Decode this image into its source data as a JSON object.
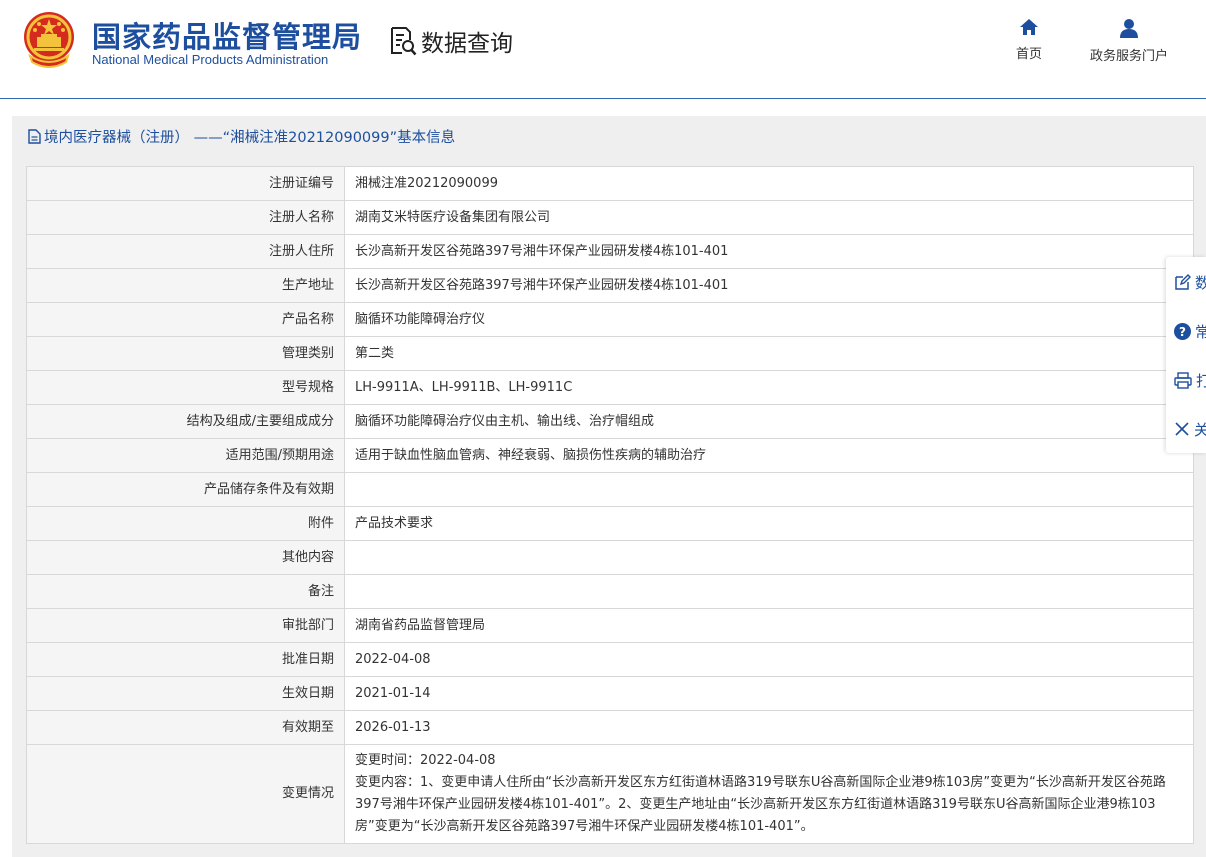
{
  "header": {
    "title_cn": "国家药品监督管理局",
    "title_en": "National Medical Products Administration",
    "query_label": "数据查询",
    "nav": {
      "home_label": "首页",
      "portal_label": "政务服务门户"
    }
  },
  "page": {
    "title": "境内医疗器械（注册） ——“湘械注准20212090099”基本信息"
  },
  "side_panel": {
    "items": [
      {
        "label": "数",
        "icon": "edit-icon"
      },
      {
        "label": "常",
        "icon": "help-icon"
      },
      {
        "label": "打",
        "icon": "print-icon"
      },
      {
        "label": "关",
        "icon": "close-icon"
      }
    ]
  },
  "details": {
    "rows": [
      {
        "label": "注册证编号",
        "value": "湘械注准20212090099"
      },
      {
        "label": "注册人名称",
        "value": "湖南艾米特医疗设备集团有限公司"
      },
      {
        "label": "注册人住所",
        "value": "长沙高新开发区谷苑路397号湘牛环保产业园研发楼4栋101-401"
      },
      {
        "label": "生产地址",
        "value": "长沙高新开发区谷苑路397号湘牛环保产业园研发楼4栋101-401"
      },
      {
        "label": "产品名称",
        "value": "脑循环功能障碍治疗仪"
      },
      {
        "label": "管理类别",
        "value": "第二类"
      },
      {
        "label": "型号规格",
        "value": "LH-9911A、LH-9911B、LH-9911C"
      },
      {
        "label": "结构及组成/主要组成成分",
        "value": "脑循环功能障碍治疗仪由主机、输出线、治疗帽组成"
      },
      {
        "label": "适用范围/预期用途",
        "value": "适用于缺血性脑血管病、神经衰弱、脑损伤性疾病的辅助治疗"
      },
      {
        "label": "产品储存条件及有效期",
        "value": ""
      },
      {
        "label": "附件",
        "value": "产品技术要求"
      },
      {
        "label": "其他内容",
        "value": ""
      },
      {
        "label": "备注",
        "value": ""
      },
      {
        "label": "审批部门",
        "value": "湖南省药品监督管理局"
      },
      {
        "label": "批准日期",
        "value": "2022-04-08"
      },
      {
        "label": "生效日期",
        "value": "2021-01-14"
      },
      {
        "label": "有效期至",
        "value": "2026-01-13"
      }
    ],
    "change": {
      "label": "变更情况",
      "time": "变更时间：2022-04-08",
      "content": "变更内容：1、变更申请人住所由“长沙高新开发区东方红街道林语路319号联东U谷高新国际企业港9栋103房”变更为“长沙高新开发区谷苑路397号湘牛环保产业园研发楼4栋101-401”。2、变更生产地址由“长沙高新开发区东方红街道林语路319号联东U谷高新国际企业港9栋103房”变更为“长沙高新开发区谷苑路397号湘牛环保产业园研发楼4栋101-401”。"
    }
  }
}
